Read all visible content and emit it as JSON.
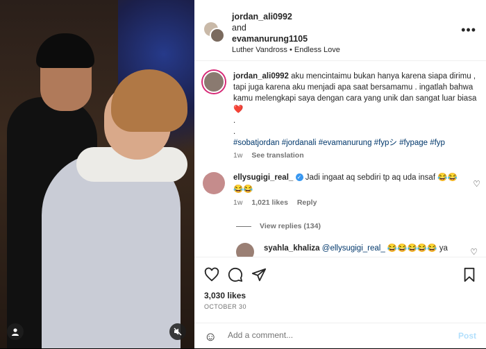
{
  "header": {
    "user1": "jordan_ali0992",
    "and_text": "and",
    "user2": "evamanurung1105",
    "audio": "Luther Vandross • Endless Love",
    "more_icon": "more-horizontal-icon"
  },
  "caption": {
    "username": "jordan_ali0992",
    "text": "aku mencintaimu bukan hanya karena siapa dirimu , tapi juga karena aku menjadi apa saat bersamamu . ingatlah bahwa kamu melengkapi saya dengan cara yang unik dan sangat luar biasa",
    "heart": "❤️",
    "dot1": ".",
    "dot2": ".",
    "hashtags": "#sobatjordan #jordanali #evamanurung #fypシ #fypage #fyp",
    "time": "1w",
    "see_translation": "See translation"
  },
  "comments": [
    {
      "username": "ellysugigi_real_",
      "verified": true,
      "text": "Jadi ingaat aq sebdiri tp aq uda insaf 😂😂😂😂",
      "time": "1w",
      "likes": "1,021 likes",
      "reply_label": "Reply",
      "view_replies": "View replies (134)"
    }
  ],
  "reply": {
    "username": "syahla_khaliza",
    "mention": "@ellysugigi_real_",
    "text": "😂😂😂😂😂 ya"
  },
  "actions": {
    "likes": "3,030 likes",
    "date": "OCTOBER 30"
  },
  "add_comment": {
    "placeholder": "Add a comment...",
    "post_label": "Post"
  }
}
